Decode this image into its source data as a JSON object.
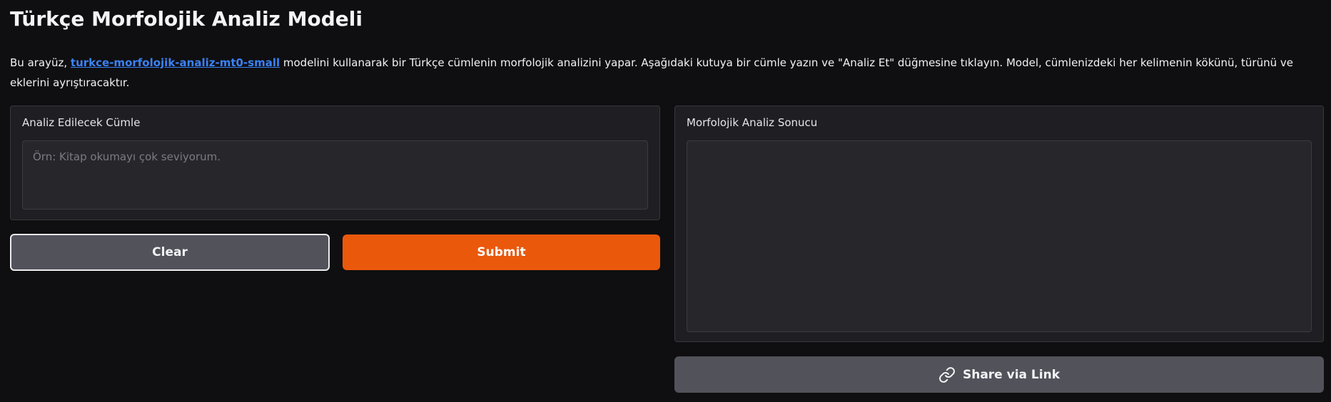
{
  "header": {
    "title": "Türkçe Morfolojik Analiz Modeli"
  },
  "description": {
    "prefix": "Bu arayüz, ",
    "link_text": "turkce-morfolojik-analiz-mt0-small",
    "suffix": " modelini kullanarak bir Türkçe cümlenin morfolojik analizini yapar. Aşağıdaki kutuya bir cümle yazın ve \"Analiz Et\" düğmesine tıklayın. Model, cümlenizdeki her kelimenin kökünü, türünü ve eklerini ayrıştıracaktır."
  },
  "input_panel": {
    "label": "Analiz Edilecek Cümle",
    "value": "",
    "placeholder": "Örn: Kitap okumayı çok seviyorum."
  },
  "output_panel": {
    "label": "Morfolojik Analiz Sonucu",
    "value": ""
  },
  "buttons": {
    "clear_label": "Clear",
    "submit_label": "Submit",
    "share_label": "Share via Link"
  },
  "icons": {
    "share": "link-icon"
  },
  "colors": {
    "background": "#0f0f11",
    "panel": "#1f1f23",
    "accent": "#ea580c",
    "link": "#3b82f6",
    "secondary_button": "#52525b"
  }
}
